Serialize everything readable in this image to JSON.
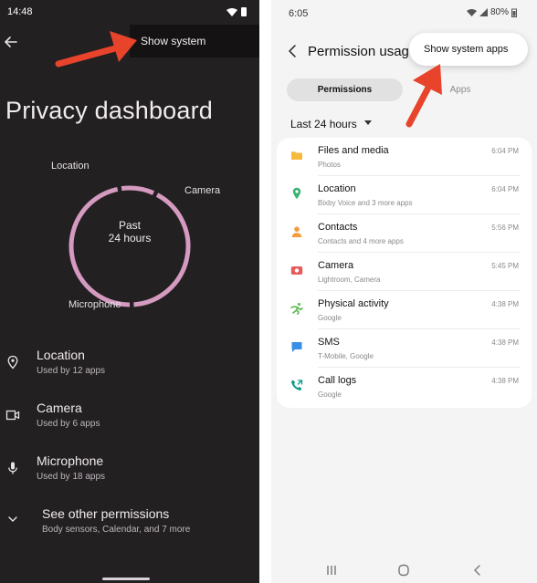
{
  "colors": {
    "left_bg": "#232022",
    "ring_pink": "#d49ac0",
    "right_bg": "#f4f4f4",
    "arrow_red": "#e8432b",
    "folder_yellow": "#f6b93b",
    "location_green": "#3bb273",
    "contacts_orange": "#f39c3a",
    "camera_red": "#e85b5b",
    "activity_green": "#58b84e",
    "sms_blue": "#3a8ee8",
    "calllog_teal": "#0e9a8c"
  },
  "left": {
    "status_time": "14:48",
    "menu_item": "Show system",
    "title": "Privacy dashboard",
    "ring": {
      "center_line1": "Past",
      "center_line2": "24 hours",
      "labels": {
        "location": "Location",
        "camera": "Camera",
        "microphone": "Microphone"
      }
    },
    "rows": [
      {
        "icon": "location-pin-icon",
        "title": "Location",
        "subtitle": "Used by 12 apps"
      },
      {
        "icon": "camera-icon",
        "title": "Camera",
        "subtitle": "Used by 6 apps"
      },
      {
        "icon": "microphone-icon",
        "title": "Microphone",
        "subtitle": "Used by 18 apps"
      },
      {
        "icon": "chevron-down-icon",
        "title": "See other permissions",
        "subtitle": "Body sensors, Calendar, and 7 more"
      }
    ]
  },
  "right": {
    "status_time": "6:05",
    "status_battery": "80%",
    "title": "Permission usage",
    "menu_item": "Show system apps",
    "tabs": [
      "Permissions",
      "Apps"
    ],
    "filter": "Last 24 hours",
    "items": [
      {
        "icon": "folder-icon",
        "name": "Files and media",
        "sub": "Photos",
        "time": "6:04 PM"
      },
      {
        "icon": "location-pin-icon",
        "name": "Location",
        "sub": "Bixby Voice and 3 more apps",
        "time": "6:04 PM"
      },
      {
        "icon": "contacts-icon",
        "name": "Contacts",
        "sub": "Contacts and 4 more apps",
        "time": "5:56 PM"
      },
      {
        "icon": "camera-icon",
        "name": "Camera",
        "sub": "Lightroom, Camera",
        "time": "5:45 PM"
      },
      {
        "icon": "running-person-icon",
        "name": "Physical activity",
        "sub": "Google",
        "time": "4:38 PM"
      },
      {
        "icon": "chat-bubble-icon",
        "name": "SMS",
        "sub": "T-Mobile, Google",
        "time": "4:38 PM"
      },
      {
        "icon": "call-log-icon",
        "name": "Call logs",
        "sub": "Google",
        "time": "4:38 PM"
      }
    ]
  }
}
